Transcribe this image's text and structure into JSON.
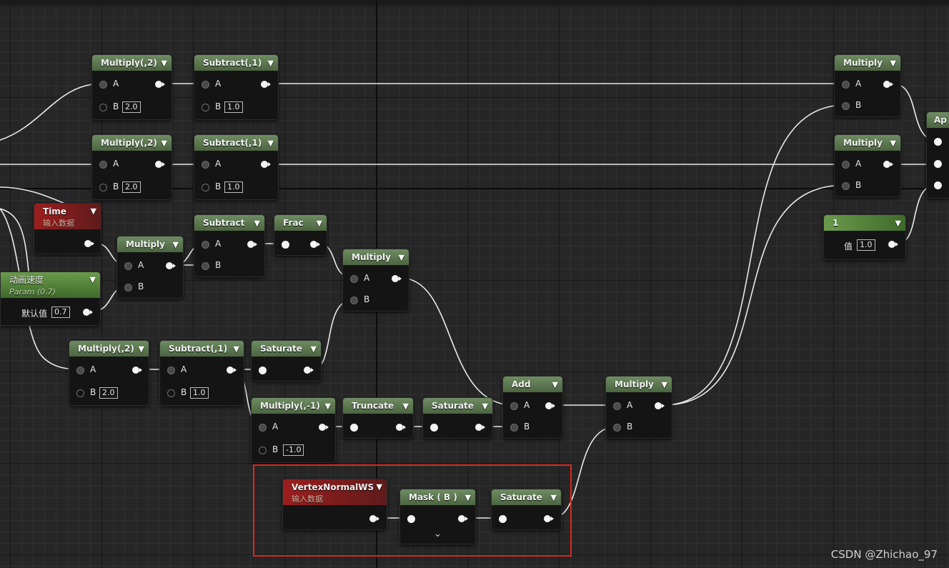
{
  "colors": {
    "grid": "#262626",
    "header": "#5f7b53",
    "red_header": "#8f1f1f",
    "highlight": "#e1251b"
  },
  "labels": {
    "a": "A",
    "b": "B",
    "value": "值",
    "default": "默认值"
  },
  "nodes": {
    "mul1": {
      "title": "Multiply(,2)",
      "b": "2.0"
    },
    "sub1": {
      "title": "Subtract(,1)",
      "b": "1.0"
    },
    "mul2": {
      "title": "Multiply(,2)",
      "b": "2.0"
    },
    "sub2": {
      "title": "Subtract(,1)",
      "b": "1.0"
    },
    "time": {
      "title": "Time",
      "subtitle": "输入数据"
    },
    "mul3": {
      "title": "Multiply"
    },
    "sub3": {
      "title": "Subtract"
    },
    "frac": {
      "title": "Frac"
    },
    "mul4": {
      "title": "Multiply"
    },
    "speed": {
      "title": "动画速度",
      "subtitle": "Param (0.7)",
      "default": "0.7"
    },
    "mul5": {
      "title": "Multiply(,2)",
      "b": "2.0"
    },
    "sub5": {
      "title": "Subtract(,1)",
      "b": "1.0"
    },
    "sat1": {
      "title": "Saturate"
    },
    "mulneg": {
      "title": "Multiply(,-1)",
      "b": "-1.0"
    },
    "trunc": {
      "title": "Truncate"
    },
    "sat2": {
      "title": "Saturate"
    },
    "add": {
      "title": "Add"
    },
    "mul6": {
      "title": "Multiply"
    },
    "vnorm": {
      "title": "VertexNormalWS",
      "subtitle": "输入数据"
    },
    "mask": {
      "title": "Mask ( B )"
    },
    "sat3": {
      "title": "Saturate"
    },
    "mulR1": {
      "title": "Multiply"
    },
    "mulR2": {
      "title": "Multiply"
    },
    "const": {
      "title": "1",
      "value": "1.0"
    },
    "append": {
      "title": "Ap"
    }
  },
  "watermark": "CSDN @Zhichao_97"
}
